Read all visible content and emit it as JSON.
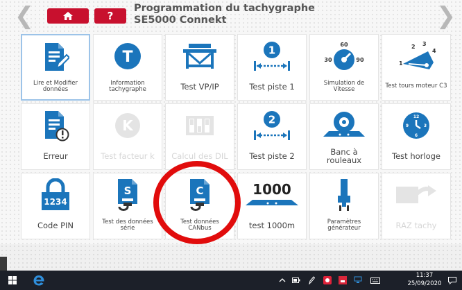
{
  "header": {
    "title_line1": "Programmation du tachygraphe",
    "title_line2": "SE5000 Connekt",
    "help_label": "?"
  },
  "tiles": [
    {
      "label": "Lire et Modifier données",
      "icon": "edit-document-icon",
      "small": true,
      "disabled": false
    },
    {
      "label": "Information tachygraphe",
      "icon": "tachograph-info-icon",
      "small": true,
      "disabled": false
    },
    {
      "label": "Test VP/IP",
      "icon": "test-bench-icon",
      "small": false,
      "disabled": false
    },
    {
      "label": "Test piste 1",
      "icon": "track-test-1-icon",
      "small": false,
      "disabled": false
    },
    {
      "label": "Simulation de Vitesse",
      "icon": "speedometer-icon",
      "small": true,
      "disabled": false
    },
    {
      "label": "Test tours moteur C3",
      "icon": "rpm-gauge-icon",
      "small": true,
      "disabled": false
    },
    {
      "label": "Erreur",
      "icon": "error-document-icon",
      "small": false,
      "disabled": false
    },
    {
      "label": "Test facteur k",
      "icon": "k-factor-icon",
      "small": false,
      "disabled": true
    },
    {
      "label": "Calcul des DIL",
      "icon": "dil-switch-icon",
      "small": false,
      "disabled": true
    },
    {
      "label": "Test piste 2",
      "icon": "track-test-2-icon",
      "small": false,
      "disabled": false
    },
    {
      "label": "Banc à rouleaux",
      "icon": "roller-bench-icon",
      "small": false,
      "disabled": false
    },
    {
      "label": "Test horloge",
      "icon": "clock-icon",
      "small": false,
      "disabled": false
    },
    {
      "label": "Code PIN",
      "icon": "pin-lock-icon",
      "small": false,
      "disabled": false
    },
    {
      "label": "Test des données série",
      "icon": "serial-data-icon",
      "small": true,
      "disabled": false
    },
    {
      "label": "Test données CANbus",
      "icon": "canbus-data-icon",
      "small": true,
      "disabled": false
    },
    {
      "label": "test 1000m",
      "icon": "distance-1000m-icon",
      "small": false,
      "disabled": false
    },
    {
      "label": "Paramètres générateur",
      "icon": "generator-plug-icon",
      "small": true,
      "disabled": false
    },
    {
      "label": "RAZ tachy",
      "icon": "reset-tachy-icon",
      "small": false,
      "disabled": true
    }
  ],
  "icon_text": {
    "track1": "1",
    "track2": "2",
    "gauge_60": "60",
    "gauge_30": "30",
    "gauge_90": "90",
    "rpm_1": "1",
    "rpm_2": "2",
    "rpm_3": "3",
    "rpm_4": "4",
    "clock_12": "12",
    "clock_3": "3",
    "clock_6": "6",
    "clock_9": "9",
    "pin_code": "1234",
    "serial_letter": "S",
    "can_letter": "C",
    "distance": "1000",
    "k_letter": "K",
    "t_letter": "T"
  },
  "taskbar": {
    "time": "11:37",
    "date": "25/09/2020"
  },
  "colors": {
    "brand_blue": "#1b75bb",
    "accent_red": "#c8102e",
    "highlight_circle": "#e10c0c",
    "disabled": "#d6d6d6"
  }
}
